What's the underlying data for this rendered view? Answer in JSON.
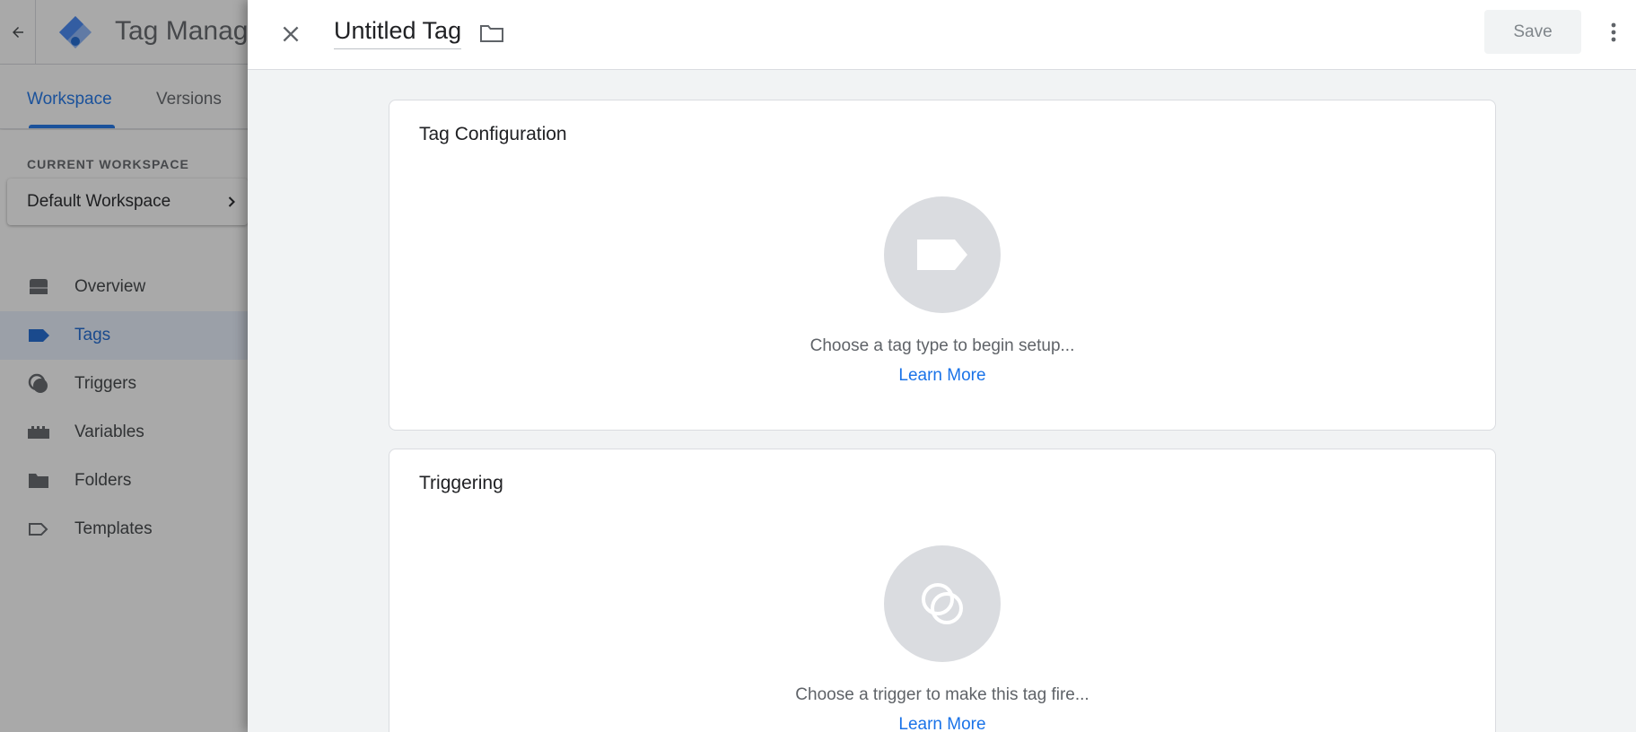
{
  "app": {
    "title": "Tag Manager",
    "tabs": [
      {
        "label": "Workspace",
        "active": true
      },
      {
        "label": "Versions",
        "active": false
      }
    ]
  },
  "sidebar": {
    "current_workspace_label": "CURRENT WORKSPACE",
    "workspace_name": "Default Workspace",
    "items": [
      {
        "label": "Overview",
        "icon": "overview-icon",
        "active": false
      },
      {
        "label": "Tags",
        "icon": "tag-icon",
        "active": true
      },
      {
        "label": "Triggers",
        "icon": "trigger-icon",
        "active": false
      },
      {
        "label": "Variables",
        "icon": "variables-icon",
        "active": false
      },
      {
        "label": "Folders",
        "icon": "folder-icon",
        "active": false
      },
      {
        "label": "Templates",
        "icon": "templates-icon",
        "active": false
      }
    ]
  },
  "panel": {
    "tag_name": "Untitled Tag",
    "save_label": "Save",
    "cards": {
      "tag_configuration": {
        "title": "Tag Configuration",
        "description": "Choose a tag type to begin setup...",
        "link": "Learn More"
      },
      "triggering": {
        "title": "Triggering",
        "description": "Choose a trigger to make this tag fire...",
        "link": "Learn More"
      }
    }
  },
  "colors": {
    "accent": "#1a73e8",
    "placeholder_circle": "#dadce0",
    "panel_background": "#f1f3f4"
  }
}
